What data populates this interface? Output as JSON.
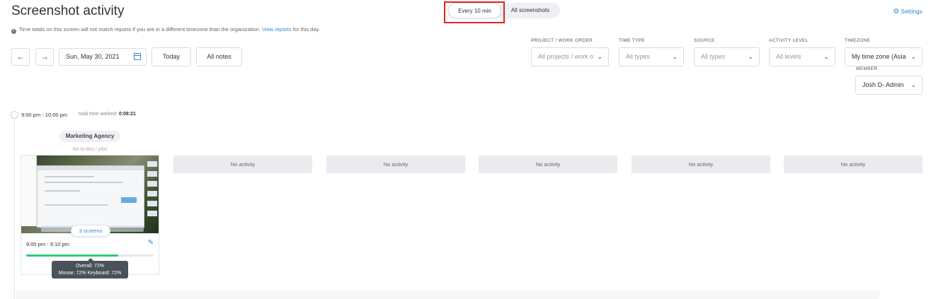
{
  "page": {
    "title": "Screenshot activity",
    "notice_text": "Time totals on this screen will not match reports if you are in a different timezone than the organization.",
    "notice_link": "View reports",
    "notice_suffix": "for this day."
  },
  "view_toggle": {
    "every_10_min": "Every 10 min",
    "all_screenshots": "All screenshots",
    "active": "every_10_min"
  },
  "settings_label": "Settings",
  "toolbar": {
    "prev_icon": "←",
    "next_icon": "→",
    "date": "Sun, May 30, 2021",
    "today_label": "Today",
    "all_notes_label": "All notes"
  },
  "filters": {
    "project": {
      "label": "PROJECT / WORK ORDER",
      "value": "All projects / work o"
    },
    "time_type": {
      "label": "TIME TYPE",
      "value": "All types"
    },
    "source": {
      "label": "SOURCE",
      "value": "All types"
    },
    "activity_level": {
      "label": "ACTIVITY LEVEL",
      "value": "All levels"
    },
    "timezone": {
      "label": "TIMEZONE",
      "value": "My time zone (Asia"
    },
    "member": {
      "label": "MEMBER",
      "value": "Josh D- Admin"
    }
  },
  "timeline": {
    "hour_range": "9:00 pm - 10:00 pm",
    "total_label": "total time worked:",
    "total_value": "0:08:21",
    "project": "Marketing Agency",
    "todos": "No to-dos / jobs",
    "screenshot": {
      "screens_label": "3 screens",
      "time": "9:00 pm - 9:10 pm",
      "activity_percent": 72,
      "tooltip_overall": "Overall: 72%",
      "tooltip_detail": "Mouse: 72% Keyboard: 72%"
    },
    "empty_slots": [
      "No activity",
      "No activity",
      "No activity",
      "No activity",
      "No activity"
    ]
  },
  "icons": {
    "settings": "gear-icon",
    "calendar": "calendar-icon",
    "edit": "pencil-icon",
    "info": "info-icon"
  },
  "colors": {
    "accent": "#2a8ad6",
    "activity_green": "#2ecc71",
    "highlight": "#e02424"
  }
}
